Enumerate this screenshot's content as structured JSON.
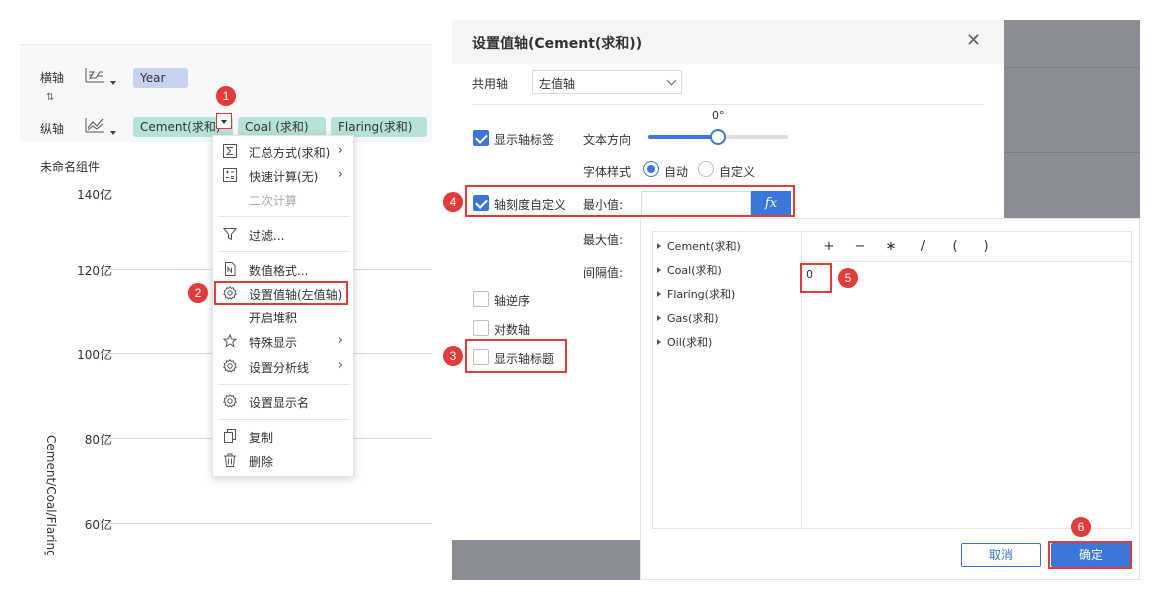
{
  "left": {
    "x_axis_label": "横轴",
    "y_axis_label": "纵轴",
    "x_field": "Year",
    "y_fields": [
      "Cement(求和)",
      "Coal (求和)",
      "Flaring(求和)"
    ],
    "component_title": "未命名组件",
    "y_ticks": [
      "140亿",
      "120亿",
      "100亿",
      "80亿",
      "60亿"
    ],
    "y_axis_title": "Cement/Coal/Flaring"
  },
  "menu": {
    "items": [
      {
        "label": "汇总方式(求和)",
        "icon": "sum-icon",
        "submenu": true
      },
      {
        "label": "快速计算(无)",
        "icon": "calculator-icon",
        "submenu": true
      },
      {
        "label": "二次计算",
        "icon": "",
        "disabled": true
      },
      {
        "label": "过滤...",
        "icon": "filter-icon"
      },
      {
        "label": "数值格式...",
        "icon": "number-format-icon"
      },
      {
        "label": "设置值轴(左值轴)",
        "icon": "gear-icon"
      },
      {
        "label": "开启堆积",
        "icon": ""
      },
      {
        "label": "特殊显示",
        "icon": "star-icon",
        "submenu": true
      },
      {
        "label": "设置分析线",
        "icon": "gear-icon",
        "submenu": true
      },
      {
        "label": "设置显示名",
        "icon": "gear-icon"
      },
      {
        "label": "复制",
        "icon": "copy-icon"
      },
      {
        "label": "删除",
        "icon": "trash-icon"
      }
    ]
  },
  "steps": [
    "1",
    "2",
    "3",
    "4",
    "5",
    "6"
  ],
  "dialog": {
    "title": "设置值轴(Cement(求和))",
    "shared_axis_label": "共用轴",
    "shared_axis_value": "左值轴",
    "show_axis_label": "显示轴标签",
    "text_direction_label": "文本方向",
    "angle": "0°",
    "angle_value": 0,
    "font_style_label": "字体样式",
    "font_auto": "自动",
    "font_custom": "自定义",
    "custom_scale_label": "轴刻度自定义",
    "min_label": "最小值:",
    "max_label": "最大值:",
    "interval_label": "间隔值:",
    "reverse_label": "轴逆序",
    "log_label": "对数轴",
    "show_title_label": "显示轴标题",
    "fx": "fx"
  },
  "formula": {
    "fields": [
      "Cement(求和)",
      "Coal(求和)",
      "Flaring(求和)",
      "Gas(求和)",
      "Oil(求和)"
    ],
    "operators": [
      "+",
      "−",
      "∗",
      "/",
      "(",
      ")"
    ],
    "value": "0",
    "cancel": "取消",
    "ok": "确定"
  },
  "colors": {
    "accent": "#3a77d8",
    "highlight": "#e33b3b",
    "pill_blue": "#c6d3ef",
    "pill_green": "#b6e2d9"
  }
}
